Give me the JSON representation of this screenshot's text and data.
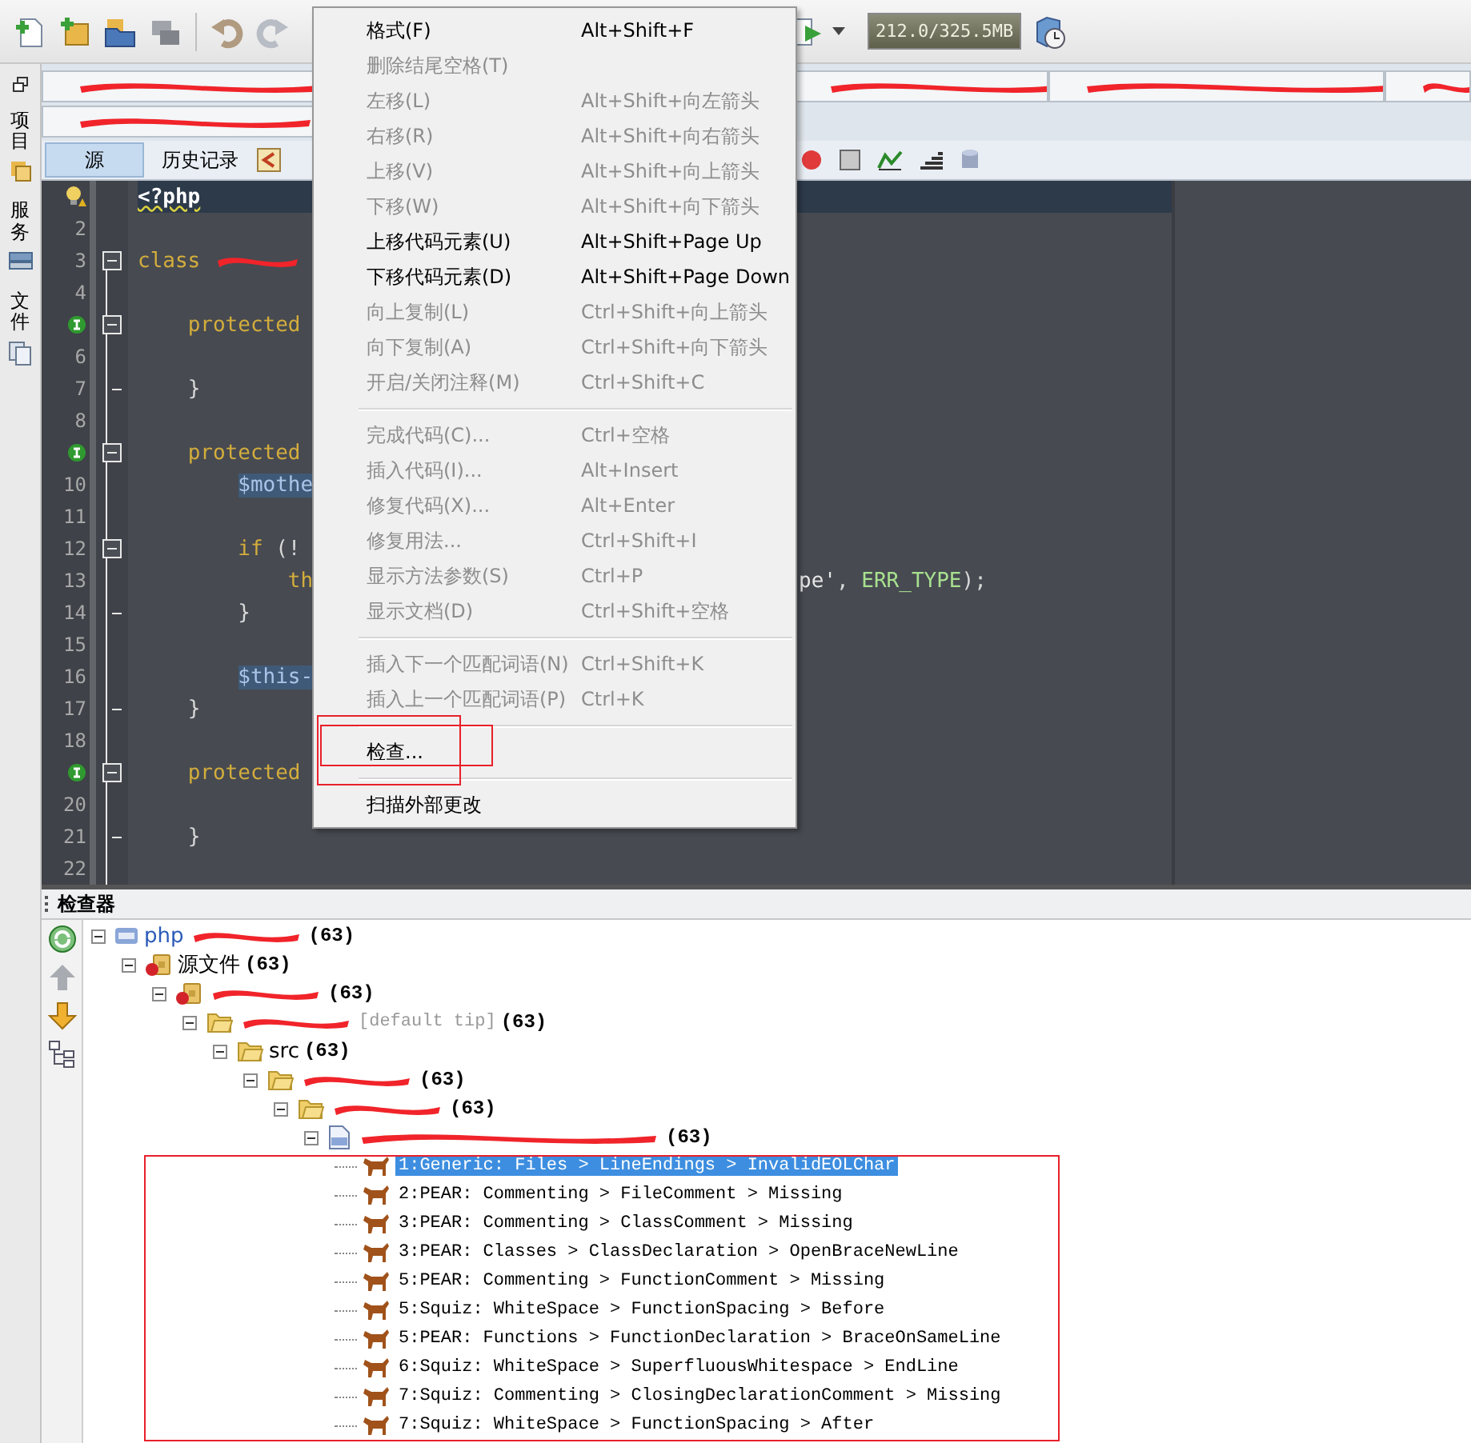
{
  "toolbar": {
    "memory": "212.0/325.5MB"
  },
  "side_tabs": [
    {
      "label": "项目"
    },
    {
      "label": "服务"
    },
    {
      "label": "文件"
    }
  ],
  "editor": {
    "view_tabs": [
      {
        "label": "源",
        "selected": true
      },
      {
        "label": "历史记录",
        "selected": false
      }
    ],
    "lines": [
      {
        "kind": "hint",
        "current": true,
        "fold_start": false,
        "fold_end": false,
        "tokens": [
          {
            "text": "<?php",
            "kind": "tag"
          }
        ]
      },
      {
        "kind": "number",
        "number": "2",
        "current": false,
        "fold_start": false,
        "fold_end": false
      },
      {
        "kind": "number",
        "number": "3",
        "current": false,
        "fold_start": true,
        "fold_end": false,
        "redacted": true,
        "tokens": [
          {
            "text": "class",
            "kind": "keyword"
          }
        ]
      },
      {
        "kind": "number",
        "number": "4",
        "current": false,
        "fold_start": false,
        "fold_end": false
      },
      {
        "kind": "implements",
        "current": false,
        "fold_start": true,
        "fold_end": false,
        "tokens": [
          {
            "text": "    protected",
            "kind": "keyword"
          }
        ]
      },
      {
        "kind": "number",
        "number": "6",
        "current": false,
        "fold_start": false,
        "fold_end": false
      },
      {
        "kind": "number",
        "number": "7",
        "current": false,
        "fold_start": false,
        "fold_end": true,
        "tokens": [
          {
            "text": "    }",
            "kind": "plain"
          }
        ]
      },
      {
        "kind": "number",
        "number": "8",
        "current": false,
        "fold_start": false,
        "fold_end": false
      },
      {
        "kind": "implements",
        "current": false,
        "fold_start": true,
        "fold_end": false,
        "tokens": [
          {
            "text": "    protected",
            "kind": "keyword"
          }
        ]
      },
      {
        "kind": "number",
        "number": "10",
        "current": false,
        "fold_start": false,
        "fold_end": false,
        "tokens": [
          {
            "text": "        $mothe",
            "kind": "occurrence"
          }
        ]
      },
      {
        "kind": "number",
        "number": "11",
        "current": false,
        "fold_start": false,
        "fold_end": false
      },
      {
        "kind": "number",
        "number": "12",
        "current": false,
        "fold_start": true,
        "fold_end": false,
        "tokens": [
          {
            "text": "        if",
            "kind": "keyword"
          },
          {
            "text": " (!",
            "kind": "plain"
          }
        ]
      },
      {
        "kind": "number",
        "number": "13",
        "current": false,
        "fold_start": false,
        "fold_end": false,
        "tokens": [
          {
            "text": "            th",
            "kind": "keyword"
          }
        ],
        "right": [
          {
            "text": "pe'",
            "kind": "string"
          },
          {
            "text": ", ",
            "kind": "plain"
          },
          {
            "text": "ERR_TYPE",
            "kind": "constant"
          },
          {
            "text": ");",
            "kind": "plain"
          }
        ]
      },
      {
        "kind": "number",
        "number": "14",
        "current": false,
        "fold_start": false,
        "fold_end": true,
        "tokens": [
          {
            "text": "        }",
            "kind": "plain"
          }
        ]
      },
      {
        "kind": "number",
        "number": "15",
        "current": false,
        "fold_start": false,
        "fold_end": false
      },
      {
        "kind": "number",
        "number": "16",
        "current": false,
        "fold_start": false,
        "fold_end": false,
        "tokens": [
          {
            "text": "        $this-",
            "kind": "occurrence"
          }
        ]
      },
      {
        "kind": "number",
        "number": "17",
        "current": false,
        "fold_start": false,
        "fold_end": true,
        "tokens": [
          {
            "text": "    }",
            "kind": "plain"
          }
        ]
      },
      {
        "kind": "number",
        "number": "18",
        "current": false,
        "fold_start": false,
        "fold_end": false
      },
      {
        "kind": "implements",
        "current": false,
        "fold_start": true,
        "fold_end": false,
        "tokens": [
          {
            "text": "    protected",
            "kind": "keyword"
          }
        ]
      },
      {
        "kind": "number",
        "number": "20",
        "current": false,
        "fold_start": false,
        "fold_end": false
      },
      {
        "kind": "number",
        "number": "21",
        "current": false,
        "fold_start": false,
        "fold_end": true,
        "tokens": [
          {
            "text": "    }",
            "kind": "plain"
          }
        ]
      },
      {
        "kind": "number",
        "number": "22",
        "current": false,
        "fold_start": false,
        "fold_end": false
      }
    ]
  },
  "context_menu": {
    "items": [
      {
        "kind": "item",
        "label": "格式(F)",
        "shortcut": "Alt+Shift+F",
        "disabled": false
      },
      {
        "kind": "item",
        "label": "删除结尾空格(T)",
        "disabled": true
      },
      {
        "kind": "item",
        "label": "左移(L)",
        "shortcut": "Alt+Shift+向左箭头",
        "disabled": true
      },
      {
        "kind": "item",
        "label": "右移(R)",
        "shortcut": "Alt+Shift+向右箭头",
        "disabled": true
      },
      {
        "kind": "item",
        "label": "上移(V)",
        "shortcut": "Alt+Shift+向上箭头",
        "disabled": true
      },
      {
        "kind": "item",
        "label": "下移(W)",
        "shortcut": "Alt+Shift+向下箭头",
        "disabled": true
      },
      {
        "kind": "item",
        "label": "上移代码元素(U)",
        "shortcut": "Alt+Shift+Page Up",
        "disabled": false
      },
      {
        "kind": "item",
        "label": "下移代码元素(D)",
        "shortcut": "Alt+Shift+Page Down",
        "disabled": false
      },
      {
        "kind": "item",
        "label": "向上复制(L)",
        "shortcut": "Ctrl+Shift+向上箭头",
        "disabled": true
      },
      {
        "kind": "item",
        "label": "向下复制(A)",
        "shortcut": "Ctrl+Shift+向下箭头",
        "disabled": true
      },
      {
        "kind": "item",
        "label": "开启/关闭注释(M)",
        "shortcut": "Ctrl+Shift+C",
        "disabled": true
      },
      {
        "kind": "separator"
      },
      {
        "kind": "item",
        "label": "完成代码(C)...",
        "shortcut": "Ctrl+空格",
        "disabled": true
      },
      {
        "kind": "item",
        "label": "插入代码(I)...",
        "shortcut": "Alt+Insert",
        "disabled": true
      },
      {
        "kind": "item",
        "label": "修复代码(X)...",
        "shortcut": "Alt+Enter",
        "disabled": true
      },
      {
        "kind": "item",
        "label": "修复用法...",
        "shortcut": "Ctrl+Shift+I",
        "disabled": true
      },
      {
        "kind": "item",
        "label": "显示方法参数(S)",
        "shortcut": "Ctrl+P",
        "disabled": true
      },
      {
        "kind": "item",
        "label": "显示文档(D)",
        "shortcut": "Ctrl+Shift+空格",
        "disabled": true
      },
      {
        "kind": "separator"
      },
      {
        "kind": "item",
        "label": "插入下一个匹配词语(N)",
        "shortcut": "Ctrl+Shift+K",
        "disabled": true
      },
      {
        "kind": "item",
        "label": "插入上一个匹配词语(P)",
        "shortcut": "Ctrl+K",
        "disabled": true
      },
      {
        "kind": "separator"
      },
      {
        "kind": "item",
        "label": "检查...",
        "disabled": false
      },
      {
        "kind": "separator"
      },
      {
        "kind": "item",
        "label": "扫描外部更改",
        "disabled": false
      }
    ]
  },
  "inspector": {
    "title": "检查器",
    "tree": {
      "kind": "project",
      "label": "php",
      "redacted": true,
      "count": "(63)",
      "expanded": true,
      "children": [
        {
          "kind": "sources",
          "label": "源文件",
          "count": "(63)",
          "expanded": true,
          "children": [
            {
              "kind": "package",
              "redacted": true,
              "count": "(63)",
              "expanded": true,
              "children": [
                {
                  "kind": "folder",
                  "redacted": true,
                  "note": "[default tip]",
                  "count": "(63)",
                  "expanded": true,
                  "children": [
                    {
                      "kind": "folder",
                      "label": "src",
                      "count": "(63)",
                      "expanded": true,
                      "children": [
                        {
                          "kind": "folder",
                          "redacted": true,
                          "count": "(63)",
                          "expanded": true,
                          "children": [
                            {
                              "kind": "folder",
                              "redacted": true,
                              "count": "(63)",
                              "expanded": true,
                              "children": [
                                {
                                  "kind": "file",
                                  "redacted": true,
                                  "count": "(63)",
                                  "expanded": true,
                                  "children": [
                                    {
                                      "kind": "issue",
                                      "label": "1:Generic: Files > LineEndings > InvalidEOLChar",
                                      "selected": true
                                    },
                                    {
                                      "kind": "issue",
                                      "label": "2:PEAR: Commenting > FileComment > Missing",
                                      "selected": false
                                    },
                                    {
                                      "kind": "issue",
                                      "label": "3:PEAR: Commenting > ClassComment > Missing",
                                      "selected": false
                                    },
                                    {
                                      "kind": "issue",
                                      "label": "3:PEAR: Classes > ClassDeclaration > OpenBraceNewLine",
                                      "selected": false
                                    },
                                    {
                                      "kind": "issue",
                                      "label": "5:PEAR: Commenting > FunctionComment > Missing",
                                      "selected": false
                                    },
                                    {
                                      "kind": "issue",
                                      "label": "5:Squiz: WhiteSpace > FunctionSpacing > Before",
                                      "selected": false
                                    },
                                    {
                                      "kind": "issue",
                                      "label": "5:PEAR: Functions > FunctionDeclaration > BraceOnSameLine",
                                      "selected": false
                                    },
                                    {
                                      "kind": "issue",
                                      "label": "6:Squiz: WhiteSpace > SuperfluousWhitespace > EndLine",
                                      "selected": false
                                    },
                                    {
                                      "kind": "issue",
                                      "label": "7:Squiz: Commenting > ClosingDeclarationComment > Missing",
                                      "selected": false
                                    },
                                    {
                                      "kind": "issue",
                                      "label": "7:Squiz: WhiteSpace > FunctionSpacing > After",
                                      "selected": false
                                    }
                                  ]
                                }
                              ]
                            }
                          ]
                        }
                      ]
                    }
                  ]
                }
              ]
            }
          ]
        }
      ]
    }
  }
}
